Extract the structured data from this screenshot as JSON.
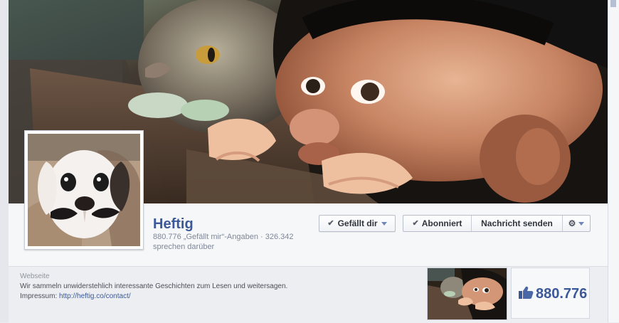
{
  "page": {
    "name": "Heftig",
    "meta_line_1": "880.776 „Gefällt mir“-Angaben · 326.342",
    "meta_line_2": "sprechen darüber"
  },
  "actions": {
    "like_button": "Gefällt dir",
    "subscribed": "Abonniert",
    "message": "Nachricht senden",
    "settings_icon": "gear-icon"
  },
  "about": {
    "label": "Webseite",
    "description": "Wir sammeln unwiderstehlich interessante Geschichten zum Lesen und weitersagen.",
    "imprint_prefix": "Impressum: ",
    "imprint_link": "http://heftig.co/contact/"
  },
  "stats": {
    "likes_count": "880.776"
  },
  "colors": {
    "brand": "#3b5998",
    "cover_dark": "#2a2119",
    "header_bg": "#f6f7f9"
  }
}
